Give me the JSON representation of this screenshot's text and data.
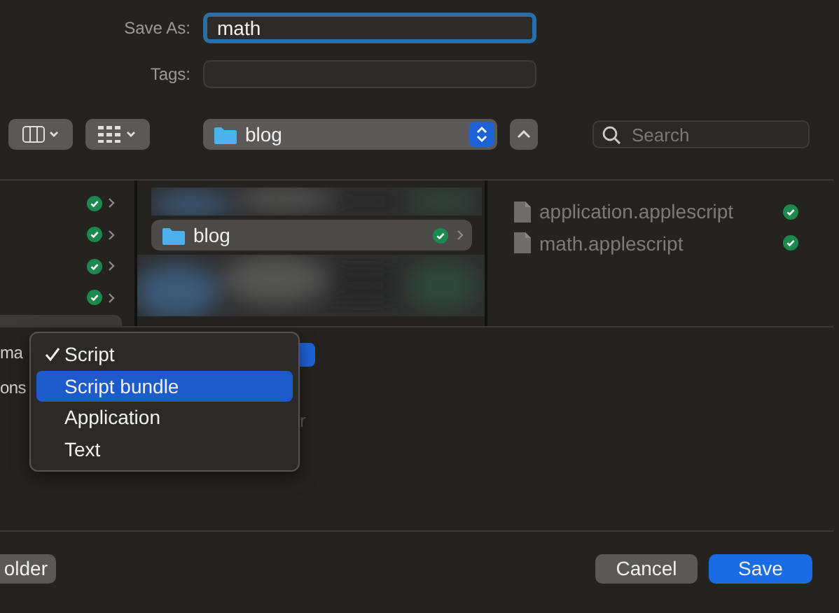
{
  "save_as": {
    "label": "Save As:",
    "value": "math"
  },
  "tags": {
    "label": "Tags:"
  },
  "toolbar": {
    "location": "blog",
    "search": {
      "placeholder": "Search"
    }
  },
  "sidebar_rows": [
    {
      "kind": "synced"
    },
    {
      "kind": "synced"
    },
    {
      "kind": "synced"
    },
    {
      "kind": "synced"
    }
  ],
  "folders": [
    {
      "kind": "picture"
    },
    {
      "kind": "folder",
      "name": "blog",
      "selected": true
    },
    {
      "kind": "picture"
    }
  ],
  "files": [
    {
      "name": "application.applescript"
    },
    {
      "name": "math.applescript"
    }
  ],
  "options": {
    "labels": [
      "ma",
      "ons"
    ],
    "hint": "r"
  },
  "format_menu": [
    {
      "label": "Script",
      "checked": true,
      "selected": false
    },
    {
      "label": "Script bundle",
      "checked": false,
      "selected": true
    },
    {
      "label": "Application",
      "checked": false,
      "selected": false
    },
    {
      "label": "Text",
      "checked": false,
      "selected": false
    }
  ],
  "buttons": {
    "new_folder": "older",
    "cancel": "Cancel",
    "save": "Save"
  }
}
